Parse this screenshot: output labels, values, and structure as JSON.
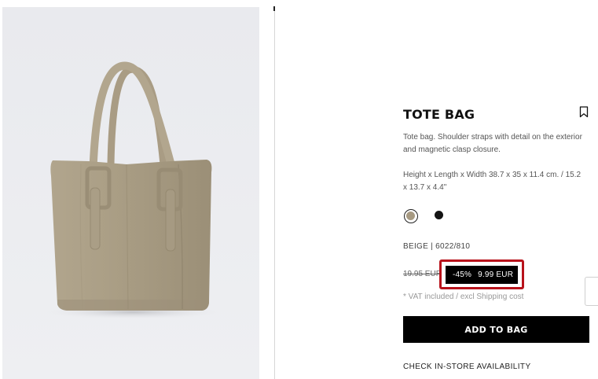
{
  "product": {
    "title": "TOTE BAG",
    "description": "Tote bag. Shoulder straps with detail on the exterior and magnetic clasp closure.",
    "dimensions": "Height x Length x Width 38.7 x 35 x 11.4 cm. / 15.2 x 13.7 x 4.4\"",
    "color_reference": "BEIGE | 6022/810",
    "image_alt": "Beige tote bag product photo"
  },
  "colors": [
    {
      "name": "beige",
      "hex": "#a79a82",
      "selected": true
    },
    {
      "name": "black",
      "hex": "#141414",
      "selected": false
    }
  ],
  "pricing": {
    "old_price": "19.95 EUR",
    "discount": "-45%",
    "sale_price": "9.99 EUR",
    "vat_note": "* VAT included / excl Shipping cost",
    "highlight_color": "#b8121b"
  },
  "actions": {
    "add_to_bag": "ADD TO BAG",
    "check_store": "CHECK IN-STORE AVAILABILITY"
  },
  "icons": {
    "bookmark": "bookmark-icon"
  }
}
